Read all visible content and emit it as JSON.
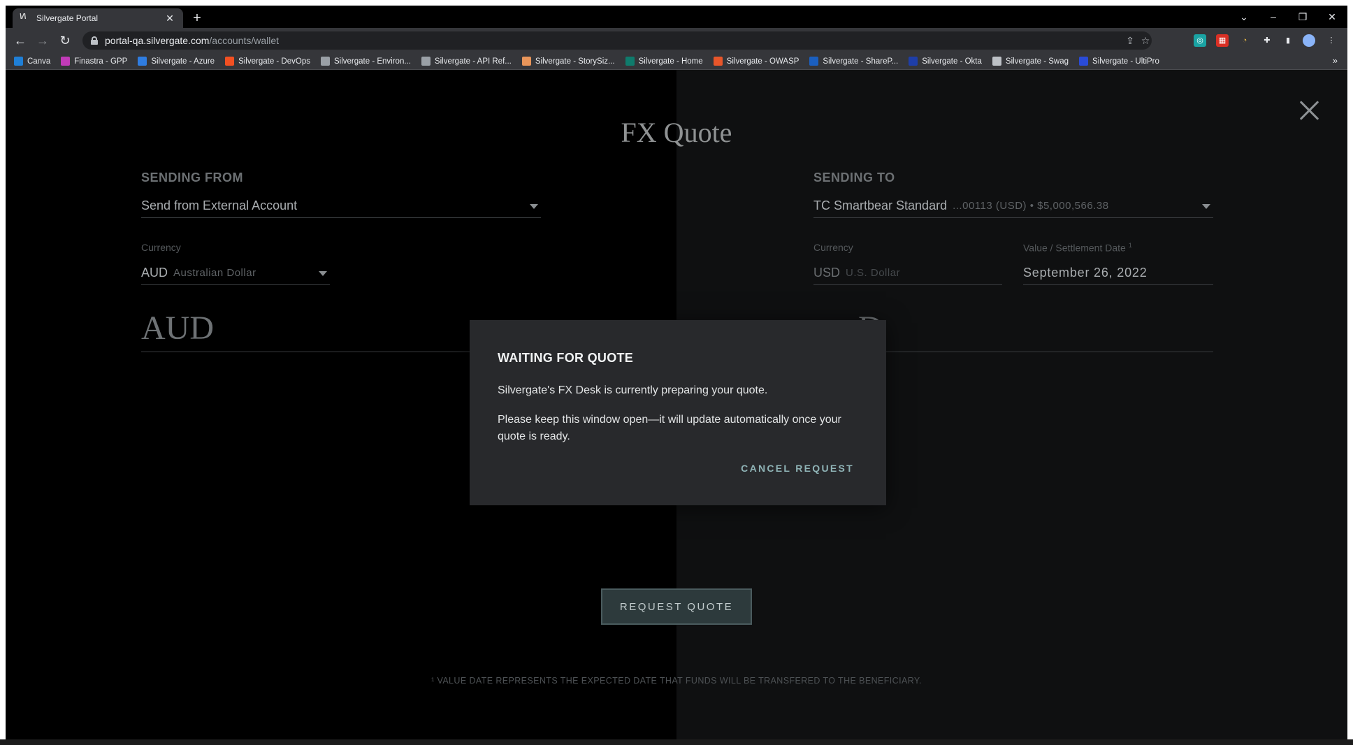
{
  "browser": {
    "tab": {
      "title": "Silvergate Portal",
      "favicon": "silvergate-logo-icon"
    },
    "url": {
      "host": "portal-qa.silvergate.com",
      "path": "/accounts/wallet"
    },
    "bookmarks": [
      {
        "label": "Canva",
        "color": "#1f7fd6"
      },
      {
        "label": "Finastra - GPP",
        "color": "#c13bb8"
      },
      {
        "label": "Silvergate - Azure",
        "color": "#2f7de1"
      },
      {
        "label": "Silvergate - DevOps",
        "color": "#f25022"
      },
      {
        "label": "Silvergate - Environ...",
        "color": "#9aa0a6"
      },
      {
        "label": "Silvergate - API Ref...",
        "color": "#9aa0a6"
      },
      {
        "label": "Silvergate - StorySiz...",
        "color": "#e8955a"
      },
      {
        "label": "Silvergate - Home",
        "color": "#0f7b6c"
      },
      {
        "label": "Silvergate - OWASP",
        "color": "#e8562a"
      },
      {
        "label": "Silvergate - ShareP...",
        "color": "#1b5fbf"
      },
      {
        "label": "Silvergate - Okta",
        "color": "#1e3ea8"
      },
      {
        "label": "Silvergate - Swag",
        "color": "#bdc1c6"
      },
      {
        "label": "Silvergate - UltiPro",
        "color": "#2a4bd6"
      }
    ]
  },
  "page": {
    "title": "FX Quote",
    "sending_from": {
      "label": "SENDING FROM",
      "account": "Send from External Account",
      "currency_label": "Currency",
      "currency_code": "AUD",
      "currency_name": "Australian Dollar",
      "amount_currency": "AUD"
    },
    "sending_to": {
      "label": "SENDING TO",
      "account_name": "TC Smartbear Standard",
      "account_detail": "...00113 (USD) • $5,000,566.38",
      "currency_label": "Currency",
      "currency_code": "USD",
      "currency_name": "U.S. Dollar",
      "value_date_label": "Value / Settlement Date",
      "value_date_sup": "1",
      "value_date": "September 26, 2022",
      "amount_partial": "D"
    },
    "request_quote_label": "REQUEST QUOTE",
    "footnote": "¹ VALUE DATE REPRESENTS THE EXPECTED DATE THAT FUNDS WILL BE TRANSFERED TO THE BENEFICIARY."
  },
  "modal": {
    "title": "WAITING FOR QUOTE",
    "line1": "Silvergate's FX Desk is currently preparing your quote.",
    "line2": "Please keep this window open—it will update automatically once your quote is ready.",
    "cancel_label": "CANCEL REQUEST"
  }
}
